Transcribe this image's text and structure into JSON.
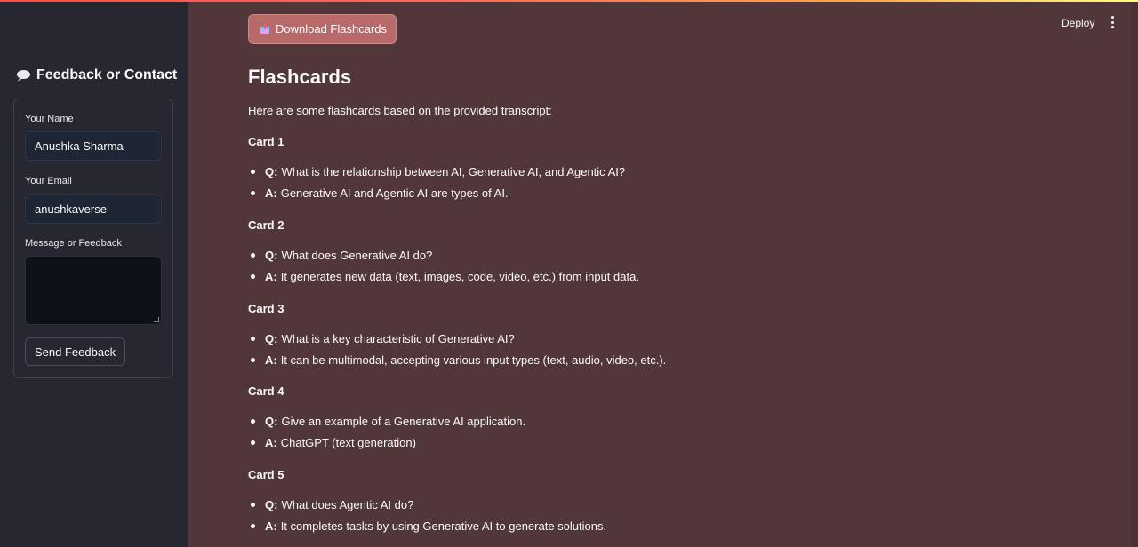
{
  "sidebar": {
    "title": "Feedback or Contact",
    "form": {
      "name_label": "Your Name",
      "name_value": "Anushka Sharma",
      "email_label": "Your Email",
      "email_value": "anushkaverse",
      "message_label": "Message or Feedback",
      "message_value": "",
      "send_label": "Send Feedback"
    }
  },
  "header": {
    "deploy_label": "Deploy",
    "menu_icon": "kebab-menu-icon"
  },
  "main": {
    "download_label": "Download Flashcards",
    "download_icon": "package-icon",
    "title": "Flashcards",
    "intro": "Here are some flashcards based on the provided transcript:",
    "cards": [
      {
        "heading": "Card 1",
        "q_prefix": "Q:",
        "q": "What is the relationship between AI, Generative AI, and Agentic AI?",
        "a_prefix": "A:",
        "a": "Generative AI and Agentic AI are types of AI."
      },
      {
        "heading": "Card 2",
        "q_prefix": "Q:",
        "q": "What does Generative AI do?",
        "a_prefix": "A:",
        "a": "It generates new data (text, images, code, video, etc.) from input data."
      },
      {
        "heading": "Card 3",
        "q_prefix": "Q:",
        "q": "What is a key characteristic of Generative AI?",
        "a_prefix": "A:",
        "a": "It can be multimodal, accepting various input types (text, audio, video, etc.)."
      },
      {
        "heading": "Card 4",
        "q_prefix": "Q:",
        "q": "Give an example of a Generative AI application.",
        "a_prefix": "A:",
        "a": "ChatGPT (text generation)"
      },
      {
        "heading": "Card 5",
        "q_prefix": "Q:",
        "q": "What does Agentic AI do?",
        "a_prefix": "A:",
        "a": "It completes tasks by using Generative AI to generate solutions."
      }
    ]
  },
  "colors": {
    "main_bg": "#52373a",
    "sidebar_bg": "#262730",
    "download_button_bg": "#b86a6a",
    "input_bg": "#1e2534"
  }
}
